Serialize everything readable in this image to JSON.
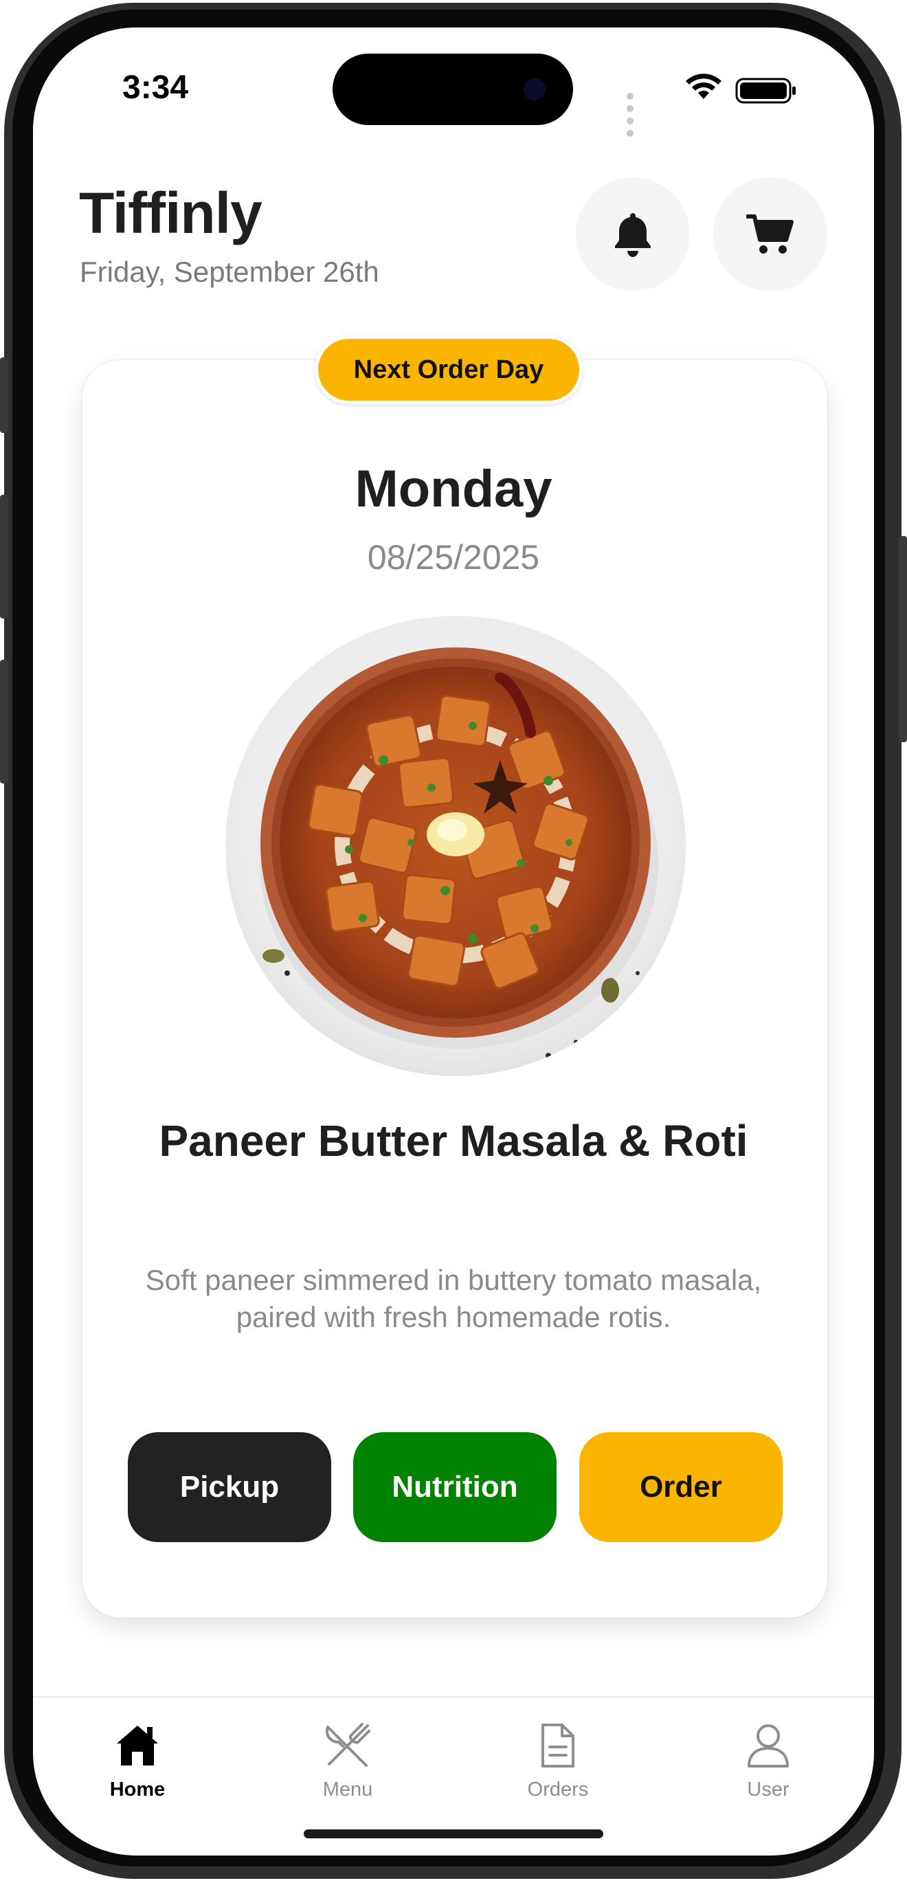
{
  "status_bar": {
    "time": "3:34"
  },
  "header": {
    "app_name": "Tiffinly",
    "date": "Friday, September 26th",
    "icons": {
      "notifications": "bell-icon",
      "cart": "cart-icon"
    }
  },
  "card": {
    "badge": "Next Order Day",
    "day": "Monday",
    "date": "08/25/2025",
    "dish_name": "Paneer Butter Masala & Roti",
    "description": "Soft paneer simmered in buttery tomato masala, paired with fresh homemade rotis.",
    "buttons": {
      "pickup": "Pickup",
      "nutrition": "Nutrition",
      "order": "Order"
    }
  },
  "colors": {
    "accent_yellow": "#FBB501",
    "nutrition_green": "#018200",
    "pickup_dark": "#222222",
    "title_text": "#1F1F1F",
    "muted_text": "#8A8A8A"
  },
  "tabbar": {
    "items": [
      {
        "label": "Home",
        "icon": "home-icon",
        "active": true
      },
      {
        "label": "Menu",
        "icon": "fork-knife-icon",
        "active": false
      },
      {
        "label": "Orders",
        "icon": "document-icon",
        "active": false
      },
      {
        "label": "User",
        "icon": "user-icon",
        "active": false
      }
    ]
  }
}
